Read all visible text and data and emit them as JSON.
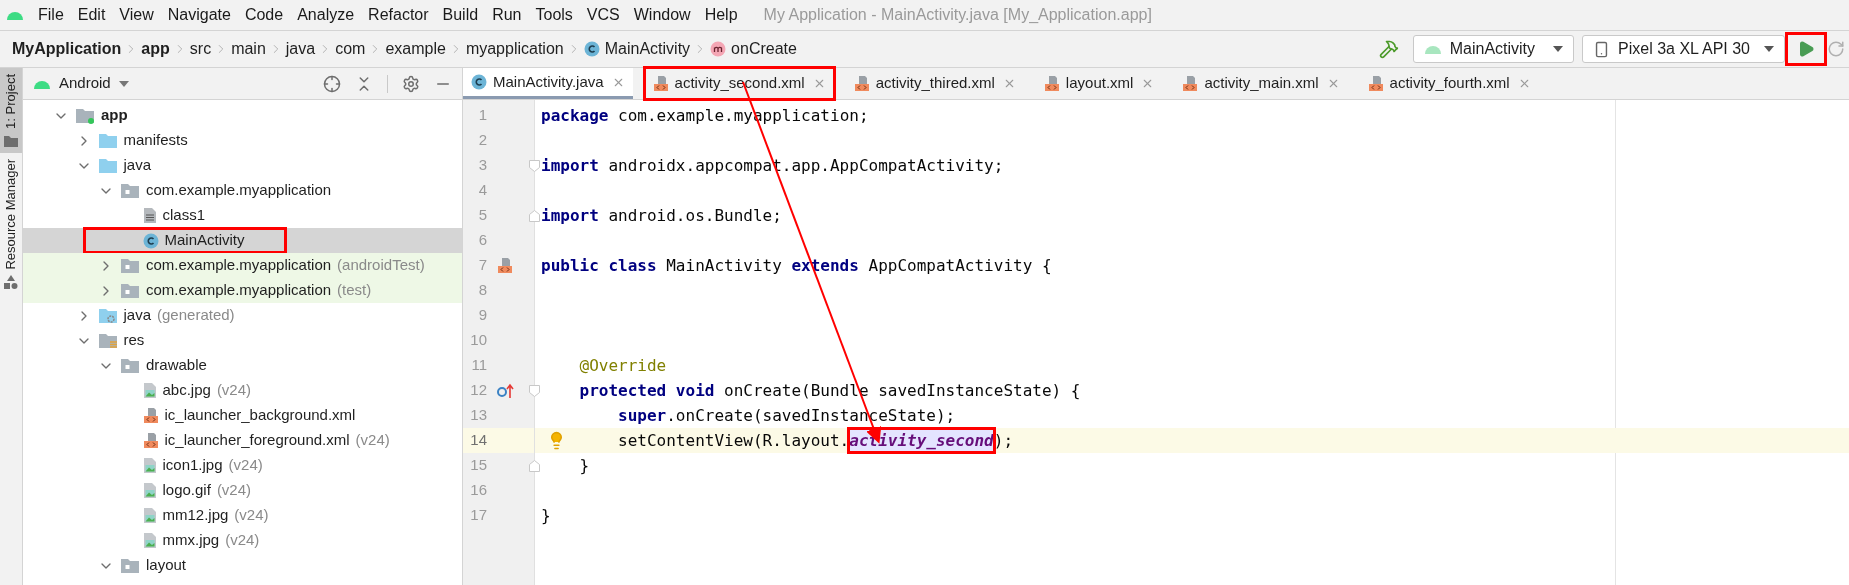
{
  "menu": [
    "File",
    "Edit",
    "View",
    "Navigate",
    "Code",
    "Analyze",
    "Refactor",
    "Build",
    "Run",
    "Tools",
    "VCS",
    "Window",
    "Help"
  ],
  "window_title": "My Application - MainActivity.java [My_Application.app]",
  "breadcrumbs": [
    {
      "label": "MyApplication",
      "kind": "module"
    },
    {
      "label": "app",
      "kind": "module"
    },
    {
      "label": "src",
      "kind": "folder"
    },
    {
      "label": "main",
      "kind": "folder"
    },
    {
      "label": "java",
      "kind": "folder"
    },
    {
      "label": "com",
      "kind": "folder"
    },
    {
      "label": "example",
      "kind": "folder"
    },
    {
      "label": "myapplication",
      "kind": "folder"
    },
    {
      "label": "MainActivity",
      "kind": "class"
    },
    {
      "label": "onCreate",
      "kind": "method"
    }
  ],
  "toolbar": {
    "run_config": "MainActivity",
    "device": "Pixel 3a XL API 30",
    "run_annotated": true
  },
  "side_strip": [
    {
      "label": "1: Project",
      "selected": true
    },
    {
      "label": "Resource Manager",
      "selected": false
    }
  ],
  "project_panel": {
    "view": "Android",
    "tree": [
      {
        "label": "app",
        "kind": "module",
        "selected": false,
        "expanded": true,
        "children": [
          {
            "label": "manifests",
            "kind": "folder",
            "selected": false,
            "expanded": false
          },
          {
            "label": "java",
            "kind": "folder",
            "selected": false,
            "expanded": true,
            "children": [
              {
                "label": "com.example.myapplication",
                "kind": "package",
                "selected": false,
                "expanded": true,
                "children": [
                  {
                    "label": "class1",
                    "kind": "file",
                    "selected": false
                  },
                  {
                    "label": "MainActivity",
                    "kind": "class",
                    "selected": true,
                    "annotated": true
                  }
                ]
              },
              {
                "label": "com.example.myapplication",
                "suffix": "(androidTest)",
                "kind": "test_package",
                "selected": false,
                "expanded": false
              },
              {
                "label": "com.example.myapplication",
                "suffix": "(test)",
                "kind": "test_package",
                "selected": false,
                "expanded": false
              }
            ]
          },
          {
            "label": "java",
            "suffix": "(generated)",
            "kind": "generated",
            "selected": false,
            "expanded": false
          },
          {
            "label": "res",
            "kind": "res",
            "selected": false,
            "expanded": true,
            "children": [
              {
                "label": "drawable",
                "kind": "package",
                "selected": false,
                "expanded": true,
                "children": [
                  {
                    "label": "abc.jpg",
                    "suffix": "(v24)",
                    "kind": "image",
                    "selected": false
                  },
                  {
                    "label": "ic_launcher_background.xml",
                    "kind": "xml",
                    "selected": false
                  },
                  {
                    "label": "ic_launcher_foreground.xml",
                    "suffix": "(v24)",
                    "kind": "xml",
                    "selected": false
                  },
                  {
                    "label": "icon1.jpg",
                    "suffix": "(v24)",
                    "kind": "image",
                    "selected": false
                  },
                  {
                    "label": "logo.gif",
                    "suffix": "(v24)",
                    "kind": "image",
                    "selected": false
                  },
                  {
                    "label": "mm12.jpg",
                    "suffix": "(v24)",
                    "kind": "image",
                    "selected": false
                  },
                  {
                    "label": "mmx.jpg",
                    "suffix": "(v24)",
                    "kind": "image",
                    "selected": false
                  }
                ]
              },
              {
                "label": "layout",
                "kind": "package",
                "selected": false,
                "expanded": true
              }
            ]
          }
        ]
      }
    ]
  },
  "editor": {
    "tabs": [
      {
        "label": "MainActivity.java",
        "kind": "class",
        "selected": true,
        "annotated": false
      },
      {
        "label": "activity_second.xml",
        "kind": "xml",
        "selected": false,
        "annotated": true
      },
      {
        "label": "activity_thired.xml",
        "kind": "xml",
        "selected": false,
        "annotated": false
      },
      {
        "label": "layout.xml",
        "kind": "xml",
        "selected": false,
        "annotated": false
      },
      {
        "label": "activity_main.xml",
        "kind": "xml",
        "selected": false,
        "annotated": false
      },
      {
        "label": "activity_fourth.xml",
        "kind": "xml",
        "selected": false,
        "annotated": false
      }
    ],
    "lines": [
      {
        "number": "1",
        "current": false,
        "tokens": [
          {
            "kind": "keyword",
            "text": "package"
          },
          {
            "kind": "plain",
            "text": " com.example.myapplication;"
          }
        ]
      },
      {
        "number": "2",
        "current": false
      },
      {
        "number": "3",
        "current": false,
        "fold": {
          "kind": "start"
        },
        "tokens": [
          {
            "kind": "keyword",
            "text": "import"
          },
          {
            "kind": "plain",
            "text": " androidx.appcompat.app.AppCompatActivity;"
          }
        ]
      },
      {
        "number": "4",
        "current": false
      },
      {
        "number": "5",
        "current": false,
        "fold": {
          "kind": "end"
        },
        "tokens": [
          {
            "kind": "keyword",
            "text": "import"
          },
          {
            "kind": "plain",
            "text": " android.os.Bundle;"
          }
        ]
      },
      {
        "number": "6",
        "current": false
      },
      {
        "number": "7",
        "current": false,
        "gutter": {
          "kind": "layout"
        },
        "tokens": [
          {
            "kind": "keyword",
            "text": "public class"
          },
          {
            "kind": "plain",
            "text": " MainActivity "
          },
          {
            "kind": "keyword",
            "text": "extends"
          },
          {
            "kind": "plain",
            "text": " AppCompatActivity {"
          }
        ]
      },
      {
        "number": "8",
        "current": false
      },
      {
        "number": "9",
        "current": false
      },
      {
        "number": "10",
        "current": false
      },
      {
        "number": "11",
        "current": false,
        "tokens": [
          {
            "kind": "annotation",
            "text": "    @Override"
          }
        ]
      },
      {
        "number": "12",
        "current": false,
        "fold": {
          "kind": "start"
        },
        "gutter": {
          "kind": "override"
        },
        "tokens": [
          {
            "kind": "keyword",
            "text": "    protected void"
          },
          {
            "kind": "plain",
            "text": " onCreate(Bundle savedInstanceState) {"
          }
        ]
      },
      {
        "number": "13",
        "current": false,
        "tokens": [
          {
            "kind": "keyword",
            "text": "        super"
          },
          {
            "kind": "plain",
            "text": ".onCreate(savedInstanceState);"
          }
        ]
      },
      {
        "number": "14",
        "current": true,
        "gutter": {
          "kind": "bulb"
        },
        "tokens": [
          {
            "kind": "plain",
            "text": "        setContentView(R.layout."
          },
          {
            "kind": "field",
            "text": "activity_second",
            "annotated": true
          },
          {
            "kind": "plain",
            "text": ");"
          }
        ]
      },
      {
        "number": "15",
        "current": false,
        "fold": {
          "kind": "end"
        },
        "tokens": [
          {
            "kind": "plain",
            "text": "    }"
          }
        ]
      },
      {
        "number": "16",
        "current": false
      },
      {
        "number": "17",
        "current": false,
        "tokens": [
          {
            "kind": "plain",
            "text": "}"
          }
        ]
      }
    ]
  }
}
